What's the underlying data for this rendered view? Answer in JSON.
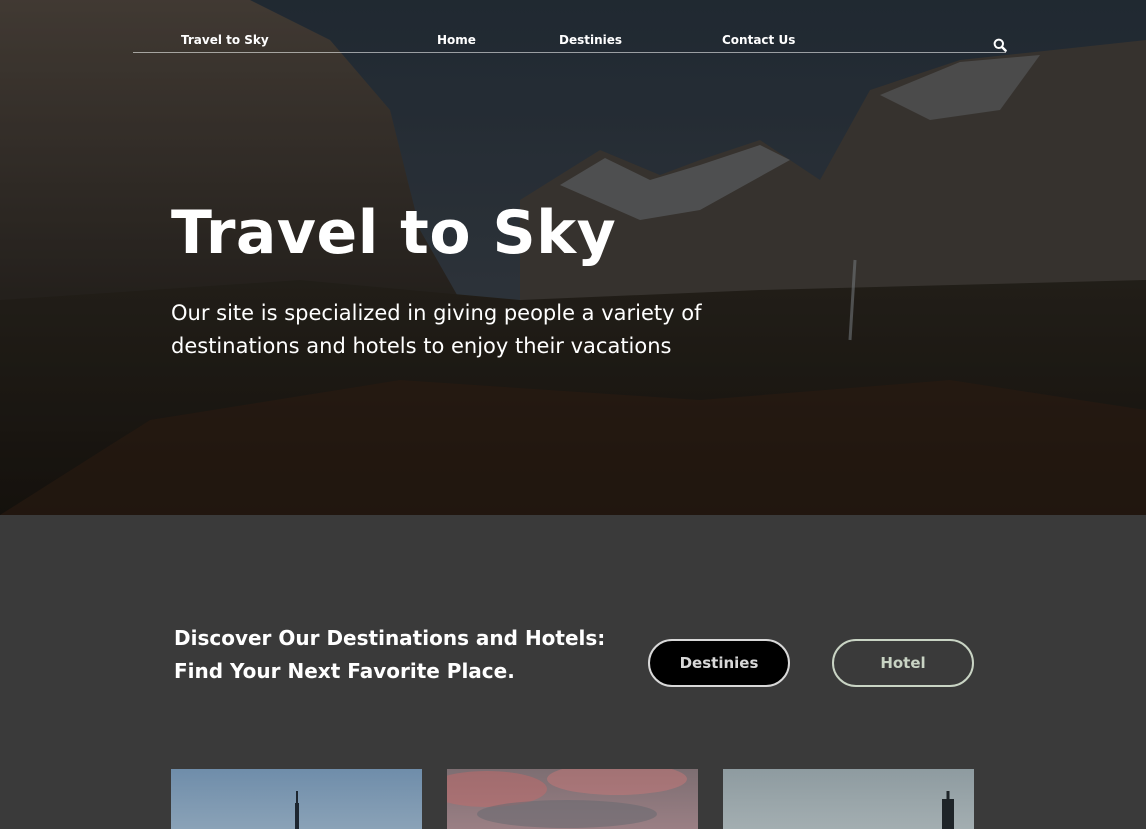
{
  "nav": {
    "brand": "Travel to Sky",
    "links": [
      "Home",
      "Destinies",
      "Contact Us"
    ],
    "search_icon": "search-icon"
  },
  "hero": {
    "title": "Travel to Sky",
    "subtitle": "Our site is specialized in giving people a variety of destinations and hotels to enjoy their vacations"
  },
  "discover": {
    "title": "Discover Our Destinations and Hotels: Find Your Next Favorite Place.",
    "buttons": [
      "Destinies",
      "Hotel"
    ]
  },
  "colors": {
    "section_bg": "#3a3a3a",
    "active_button_bg": "#000000",
    "hotel_button_border": "#c9d4c4"
  }
}
